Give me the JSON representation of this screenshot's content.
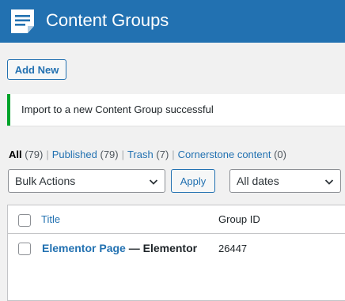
{
  "header": {
    "title": "Content Groups",
    "icon": "document-list-icon"
  },
  "actions": {
    "add_new_label": "Add New"
  },
  "notice": {
    "text": "Import to a new Content Group successful"
  },
  "views": [
    {
      "label": "All",
      "count": "(79)",
      "current": true
    },
    {
      "label": "Published",
      "count": "(79)",
      "current": false
    },
    {
      "label": "Trash",
      "count": "(7)",
      "current": false
    },
    {
      "label": "Cornerstone content",
      "count": "(0)",
      "current": false
    }
  ],
  "bulk": {
    "selected": "Bulk Actions",
    "apply_label": "Apply"
  },
  "date_filter": {
    "selected": "All dates"
  },
  "table": {
    "columns": [
      "Title",
      "Group ID"
    ],
    "rows": [
      {
        "title": "Elementor Page",
        "suffix": " — Elementor",
        "group_id": "26447"
      }
    ]
  },
  "colors": {
    "accent": "#2271b1",
    "success": "#00a32a",
    "background": "#f1f1f1"
  }
}
